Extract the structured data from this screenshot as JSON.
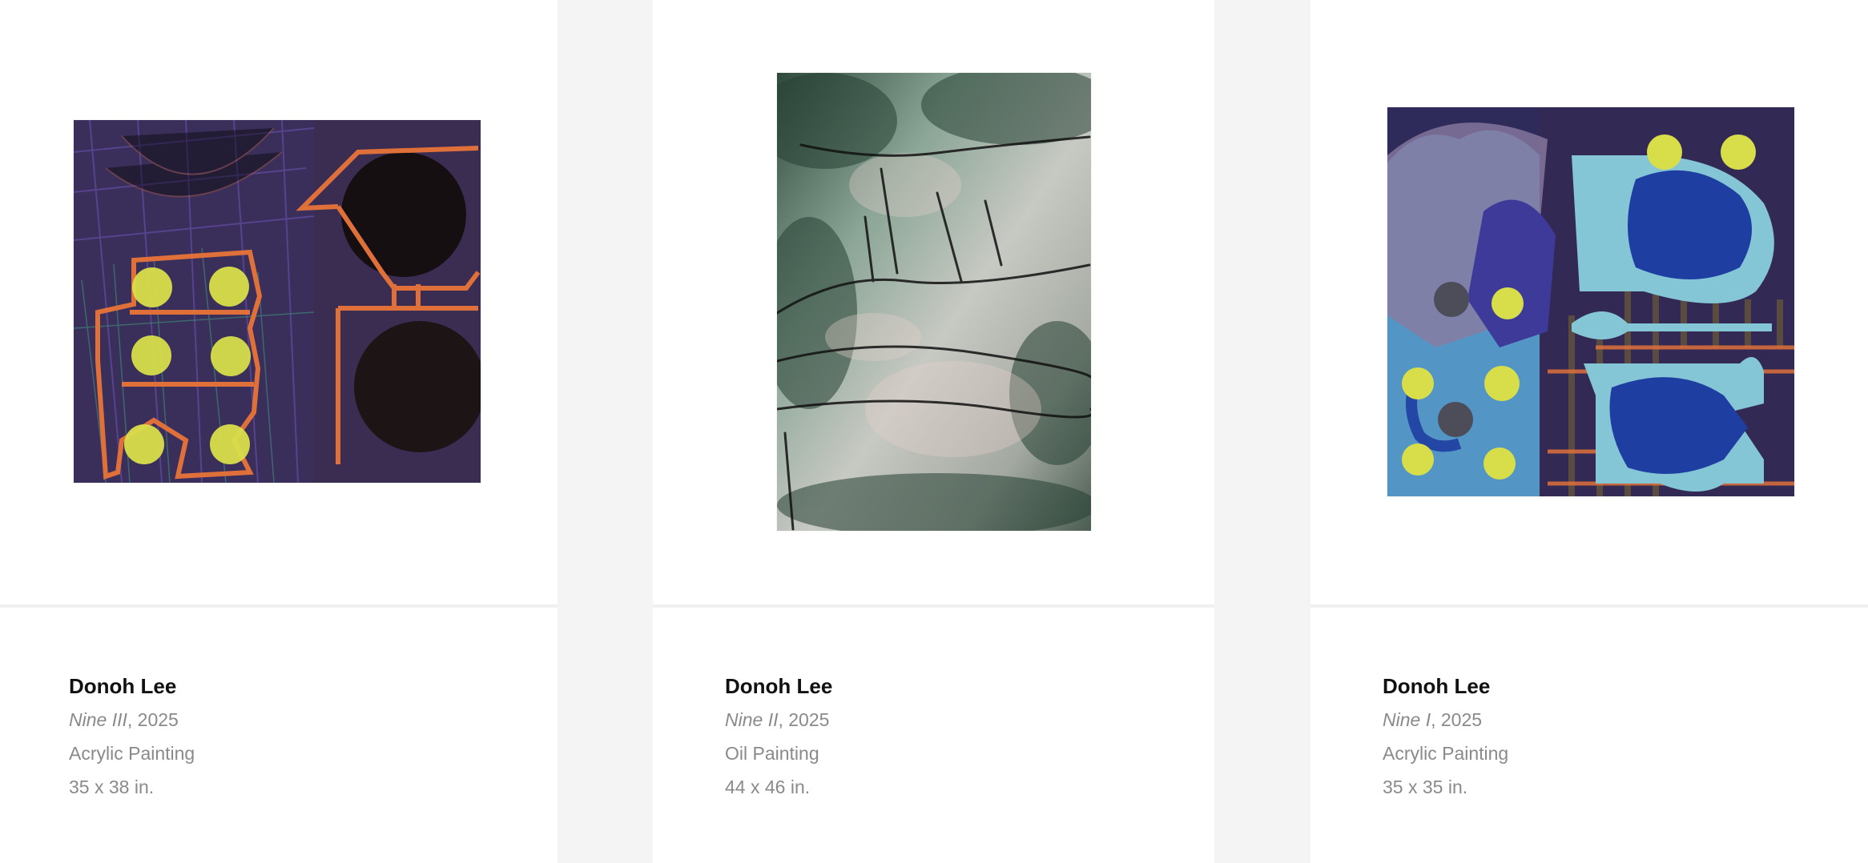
{
  "artworks": [
    {
      "artist": "Donoh Lee",
      "title": "Nine III",
      "year": ", 2025",
      "medium": "Acrylic Painting",
      "dimensions": "35 x 38 in."
    },
    {
      "artist": "Donoh Lee",
      "title": "Nine II",
      "year": ", 2025",
      "medium": "Oil Painting",
      "dimensions": "44 x 46 in."
    },
    {
      "artist": "Donoh Lee",
      "title": "Nine I",
      "year": ", 2025",
      "medium": "Acrylic Painting",
      "dimensions": "35 x 35 in."
    }
  ],
  "colors": {
    "page_background": "#f4f4f4",
    "card_background": "#ffffff",
    "artist_text": "#111111",
    "secondary_text": "#8a8a8a",
    "divider": "#f0f0f0"
  }
}
